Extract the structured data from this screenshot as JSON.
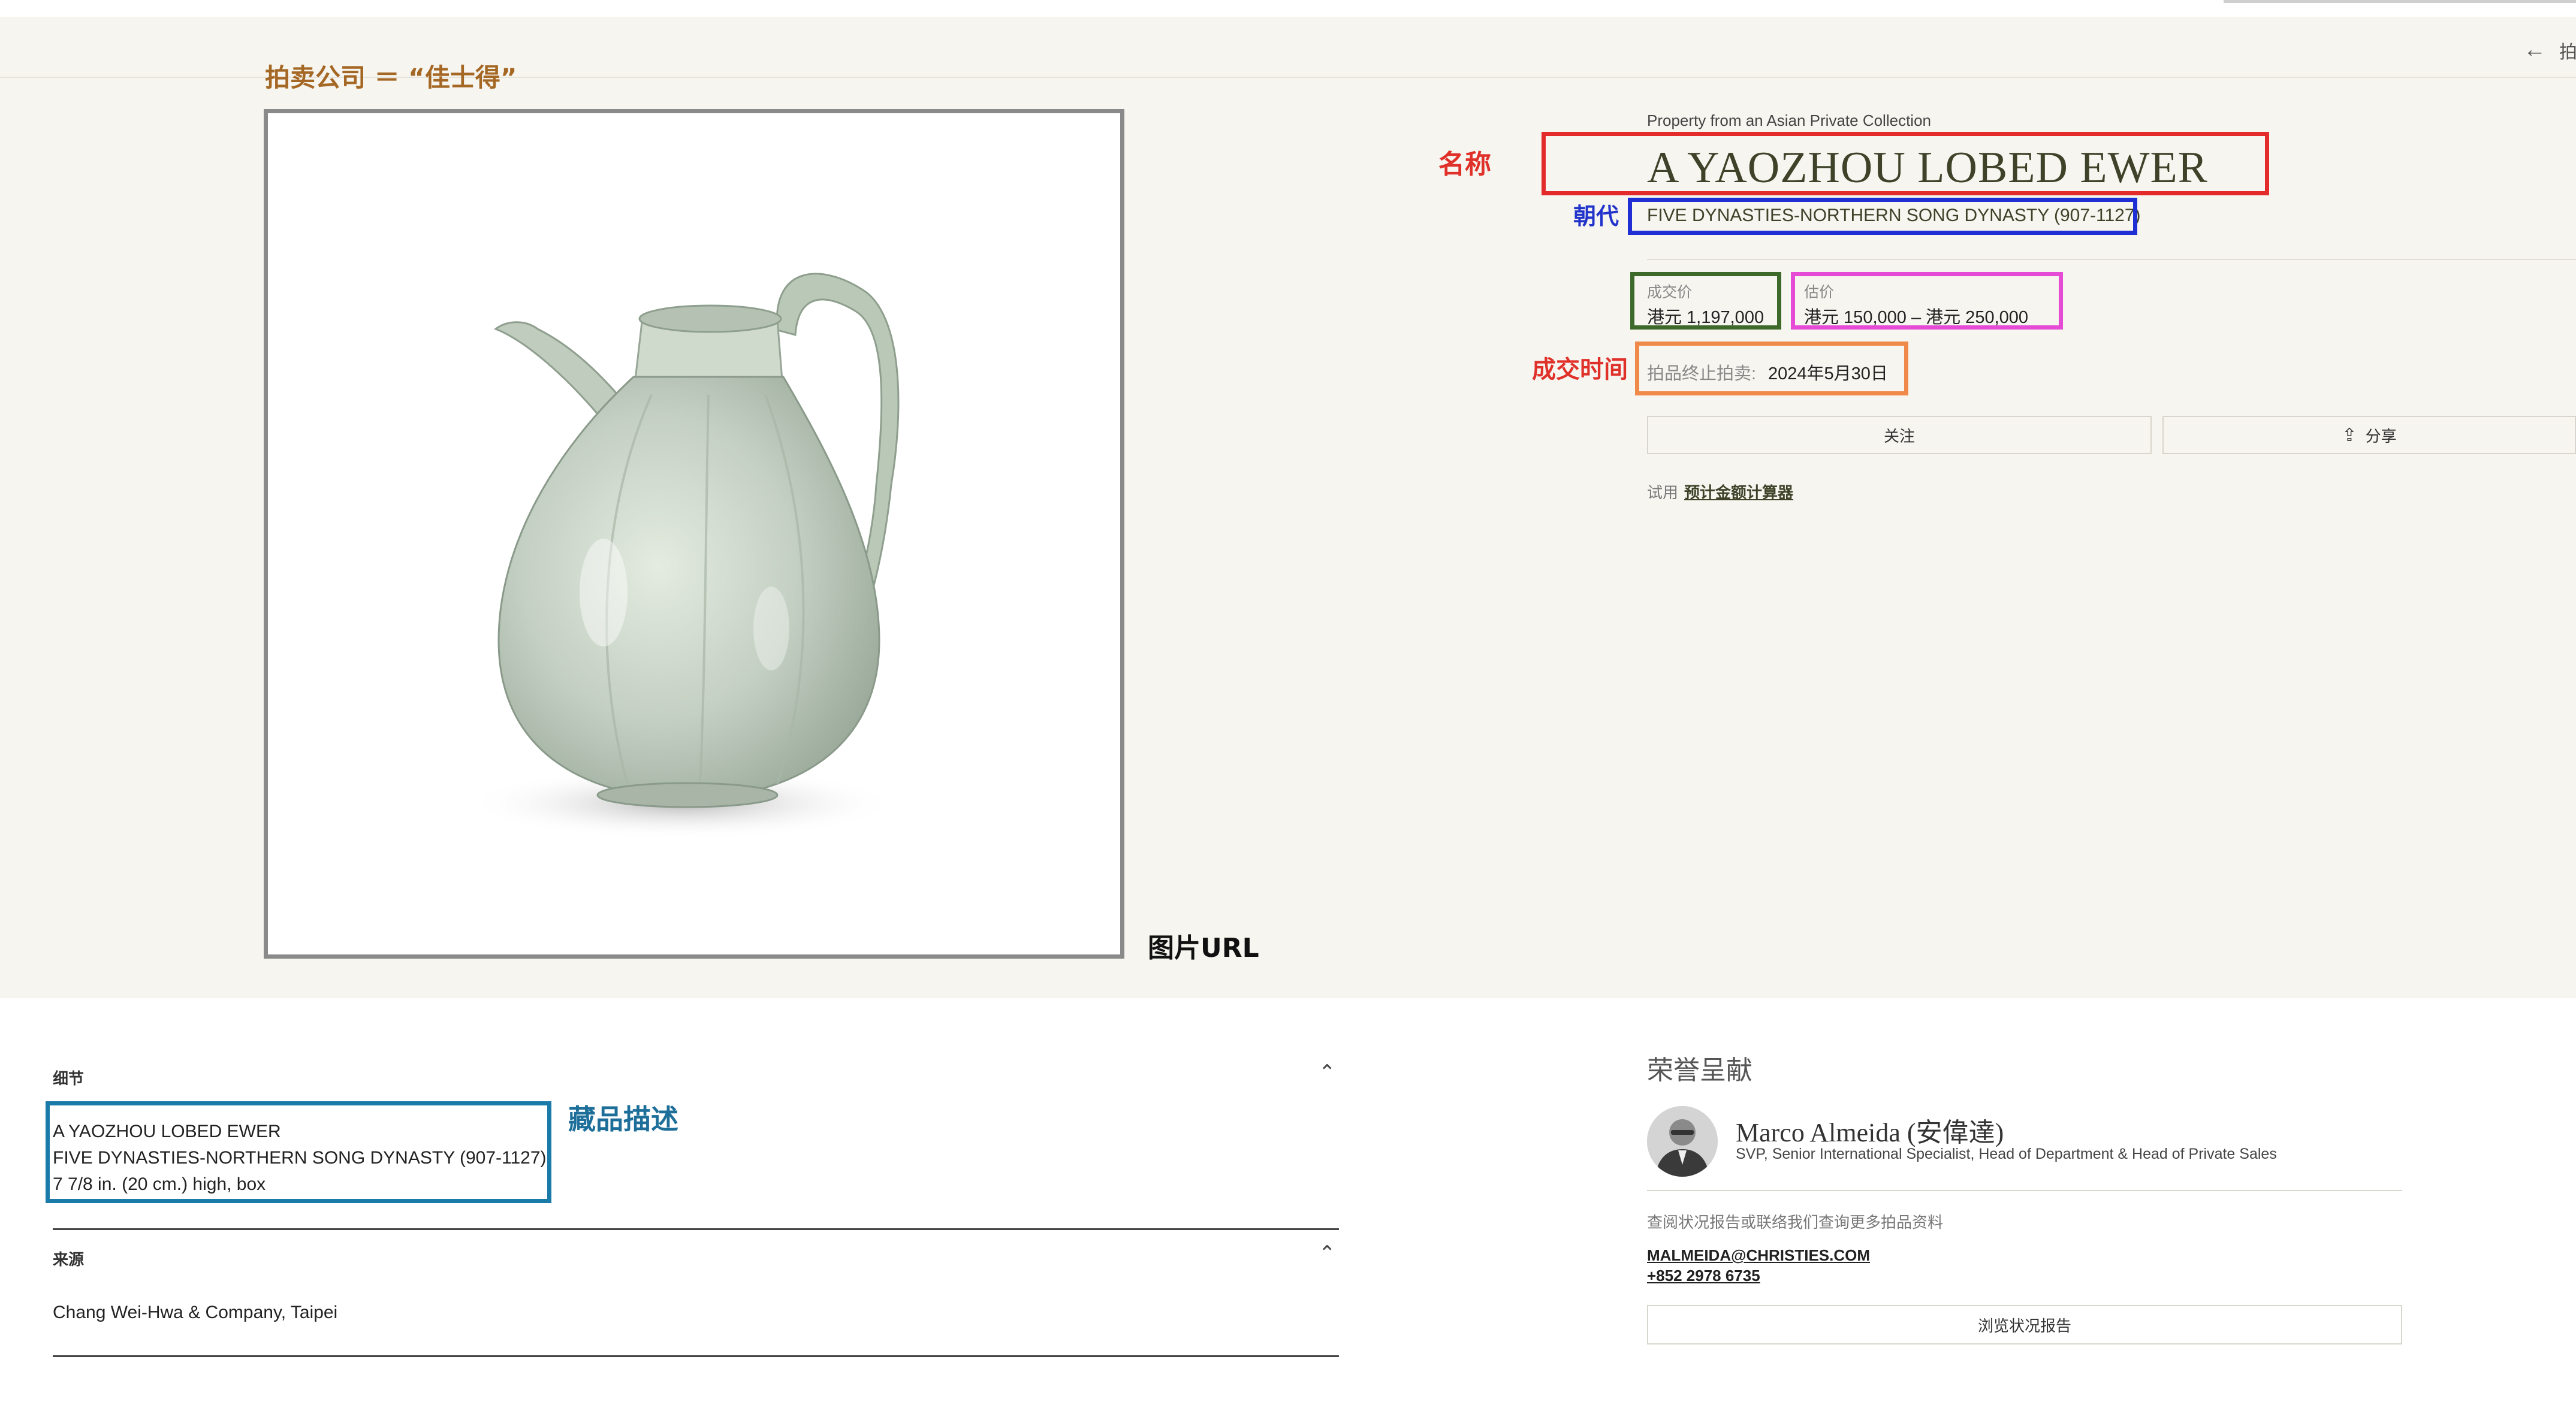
{
  "annotations": {
    "auction_house": "拍卖公司 ＝ “佳士得”",
    "name": "名称",
    "dynasty": "朝代",
    "deal_time": "成交时间",
    "image_url": "图片URL",
    "description": "藏品描述"
  },
  "nav": {
    "back_icon": "arrow-left-icon",
    "back_label": "拍"
  },
  "lot": {
    "subtitle": "Property from an Asian Private Collection",
    "title": "A YAOZHOU LOBED EWER",
    "dynasty": "FIVE DYNASTIES-NORTHERN SONG DYNASTY (907-1127)",
    "price_label": "成交价",
    "price_value": "港元 1,197,000",
    "estimate_label": "估价",
    "estimate_value": "港元 150,000 – 港元 250,000",
    "closing_label": "拍品终止拍卖:",
    "closing_value": "2024年5月30日",
    "follow_label": "关注",
    "share_icon": "share-icon",
    "share_label": "分享",
    "trial_prefix": "试用",
    "trial_link": "预计金额计算器"
  },
  "details": {
    "heading": "细节",
    "lines": [
      "A YAOZHOU LOBED EWER",
      "FIVE DYNASTIES-NORTHERN SONG DYNASTY (907-1127)",
      "7 7/8 in. (20 cm.) high, box"
    ],
    "provenance_heading": "来源",
    "provenance_text": "Chang Wei-Hwa & Company, Taipei"
  },
  "specialist": {
    "heading": "荣誉呈献",
    "name": "Marco Almeida (安偉達)",
    "role": "SVP, Senior International Specialist, Head of Department & Head of Private Sales",
    "contact_note": "查阅状况报告或联络我们查询更多拍品资料",
    "email": "MALMEIDA@CHRISTIES.COM",
    "phone": "+852 2978 6735",
    "report_button": "浏览状况报告"
  },
  "colors": {
    "hero_background": "#f6f5ef",
    "title_olive": "#3d4228",
    "box_name_red": "#e32b2b",
    "box_dynasty_blue": "#1f2fd4",
    "box_price_green": "#3d6a2a",
    "box_estimate_magenta": "#e64bd6",
    "box_time_orange": "#f08a4a",
    "box_description_teal": "#1a7aa8"
  }
}
